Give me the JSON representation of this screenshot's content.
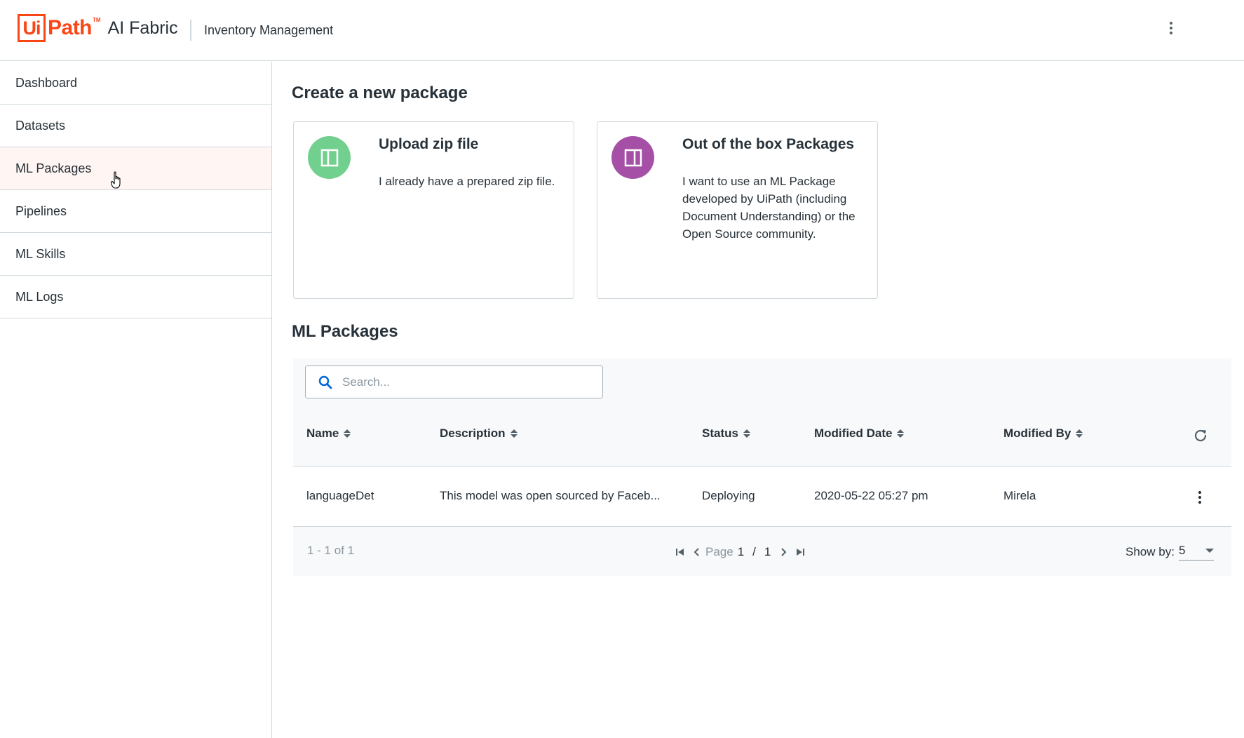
{
  "header": {
    "logo_ui": "Ui",
    "logo_path": "Path",
    "logo_tm": "TM",
    "product": "AI Fabric",
    "tenant": "Inventory Management",
    "menu_icon": "more-vertical-icon"
  },
  "sidebar": {
    "items": [
      {
        "label": "Dashboard"
      },
      {
        "label": "Datasets"
      },
      {
        "label": "ML Packages",
        "active": true
      },
      {
        "label": "Pipelines"
      },
      {
        "label": "ML Skills"
      },
      {
        "label": "ML Logs"
      }
    ]
  },
  "create": {
    "title": "Create a new package",
    "cards": [
      {
        "title": "Upload zip file",
        "description": "I already have a prepared zip file.",
        "icon": "panel-left-icon",
        "color": "#72d08f"
      },
      {
        "title": "Out of the box Packages",
        "description": "I want to use an ML Package developed by UiPath (including Document Understanding) or the Open Source community.",
        "icon": "panel-right-icon",
        "color": "#a550a6"
      }
    ]
  },
  "packages": {
    "title": "ML Packages",
    "search_placeholder": "Search...",
    "columns": [
      "Name",
      "Description",
      "Status",
      "Modified Date",
      "Modified By"
    ],
    "rows": [
      {
        "name": "languageDet",
        "description": "This model was open sourced by Faceb...",
        "status": "Deploying",
        "modified_date": "2020-05-22 05:27 pm",
        "modified_by": "Mirela"
      }
    ],
    "footer": {
      "count": "1 - 1 of 1",
      "page_label": "Page",
      "page_current": "1",
      "page_sep": "/",
      "page_total": "1",
      "show_by_label": "Show by:",
      "show_by_value": "5"
    }
  },
  "colors": {
    "brand": "#fa4616",
    "active_bg": "#fff5f2",
    "border": "#cfd8dd",
    "accent_blue": "#0067df"
  }
}
